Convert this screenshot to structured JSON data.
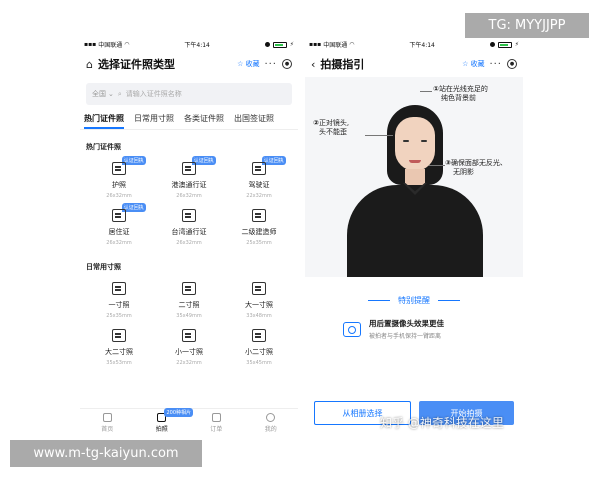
{
  "overlays": {
    "tg_label": "TG: MYYJJPP",
    "site_label": "www.m-tg-kaiyun.com",
    "zhihu_label": "知乎 @神奇科技在这里"
  },
  "left": {
    "status": {
      "carrier": "中国联通",
      "time": "下午4:14"
    },
    "header": {
      "title": "选择证件照类型",
      "fav": "收藏",
      "more": "···"
    },
    "search": {
      "region": "全国",
      "placeholder": "请输入证件照名称"
    },
    "tabs": [
      "热门证件照",
      "日常用寸照",
      "各类证件照",
      "出国签证照"
    ],
    "sections": {
      "hot_title": "热门证件照",
      "daily_title": "日常用寸照"
    },
    "hot_items": [
      {
        "name": "护照",
        "size": "26x32mm",
        "badge": "认证回执"
      },
      {
        "name": "港澳通行证",
        "size": "26x32mm",
        "badge": "认证回执"
      },
      {
        "name": "驾驶证",
        "size": "22x32mm",
        "badge": "认证回执"
      },
      {
        "name": "居住证",
        "size": "26x32mm",
        "badge": "认证回执"
      },
      {
        "name": "台湾通行证",
        "size": "26x32mm",
        "badge": "认证回执"
      },
      {
        "name": "二级建造师",
        "size": "25x35mm",
        "badge": ""
      }
    ],
    "daily_items": [
      {
        "name": "一寸照",
        "size": "25x35mm"
      },
      {
        "name": "二寸照",
        "size": "35x49mm"
      },
      {
        "name": "大一寸照",
        "size": "33x48mm"
      },
      {
        "name": "大二寸照",
        "size": "35x53mm"
      },
      {
        "name": "小一寸照",
        "size": "22x32mm"
      },
      {
        "name": "小二寸照",
        "size": "35x45mm"
      }
    ],
    "tabbar": [
      {
        "label": "首页",
        "badge": ""
      },
      {
        "label": "拍照",
        "badge": "200种相片"
      },
      {
        "label": "订单",
        "badge": ""
      },
      {
        "label": "我的",
        "badge": ""
      }
    ]
  },
  "right": {
    "status": {
      "carrier": "中国联通",
      "time": "下午4:14"
    },
    "header": {
      "title": "拍摄指引",
      "fav": "收藏",
      "more": "···"
    },
    "annotations": {
      "a1_num": "①",
      "a1_line1": "站在光线充足的",
      "a1_line2": "纯色背景前",
      "a2_num": "②",
      "a2_line1": "正对镜头,",
      "a2_line2": "头不能歪",
      "a3_num": "③",
      "a3_line1": "确保面部无反光、",
      "a3_line2": "无阴影"
    },
    "tip_title": "特别提醒",
    "tip_main": "用后置摄像头效果更佳",
    "tip_sub": "被拍者与手机保持一臂距离",
    "btn_album": "从相册选择",
    "btn_shoot": "开始拍摄"
  },
  "colors": {
    "accent": "#1677ff",
    "badge": "#4a8ef5"
  }
}
